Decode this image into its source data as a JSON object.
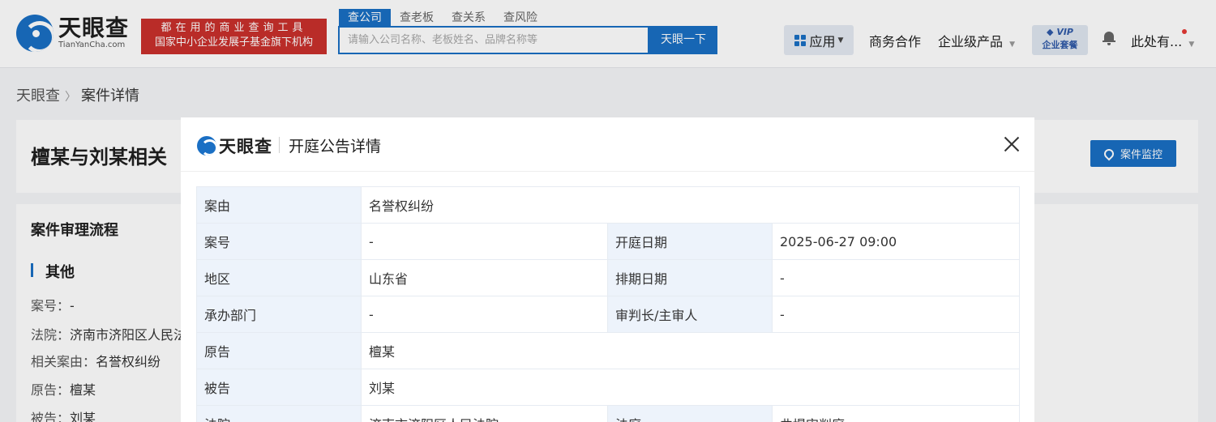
{
  "header": {
    "logo_cn": "天眼查",
    "logo_en": "TianYanCha.com",
    "slogan_line1": "都在用的商业查询工具",
    "slogan_line2": "国家中小企业发展子基金旗下机构",
    "search_tabs": [
      "查公司",
      "查老板",
      "查关系",
      "查风险"
    ],
    "search_placeholder": "请输入公司名称、老板姓名、品牌名称等",
    "search_button": "天眼一下",
    "nav_app": "应用",
    "nav_business": "商务合作",
    "nav_enterprise": "企业级产品",
    "vip_line1": "VIP",
    "vip_line2": "企业套餐",
    "user_name": "此处有..."
  },
  "breadcrumb": {
    "home": "天眼查",
    "current": "案件详情"
  },
  "page": {
    "case_title": "檀某与刘某相关",
    "monitor_button": "案件监控",
    "flow_title": "案件审理流程",
    "section_title": "其他",
    "info": [
      {
        "label": "案号：",
        "value": "-"
      },
      {
        "label": "法院：",
        "value": "济南市济阳区人民法"
      },
      {
        "label": "相关案由：",
        "value": "名誉权纠纷"
      },
      {
        "label": "原告：",
        "value": "檀某"
      },
      {
        "label": "被告：",
        "value": "刘某"
      }
    ]
  },
  "modal": {
    "logo_text": "天眼查",
    "title": "开庭公告详情",
    "rows": {
      "r1": {
        "l1": "案由",
        "v1": "名誉权纠纷"
      },
      "r2": {
        "l1": "案号",
        "v1": "-",
        "l2": "开庭日期",
        "v2": "2025-06-27 09:00"
      },
      "r3": {
        "l1": "地区",
        "v1": "山东省",
        "l2": "排期日期",
        "v2": "-"
      },
      "r4": {
        "l1": "承办部门",
        "v1": "-",
        "l2": "审判长/主审人",
        "v2": "-"
      },
      "r5": {
        "l1": "原告",
        "v1": "檀某"
      },
      "r6": {
        "l1": "被告",
        "v1": "刘某"
      },
      "r7": {
        "l1": "法院",
        "v1": "济南市济阳区人民法院",
        "l2": "法庭",
        "v2": "曲堤审判庭"
      }
    }
  },
  "colors": {
    "brand_blue": "#1a6fc4",
    "slogan_red": "#c9302c",
    "label_bg": "#edf3fb"
  }
}
